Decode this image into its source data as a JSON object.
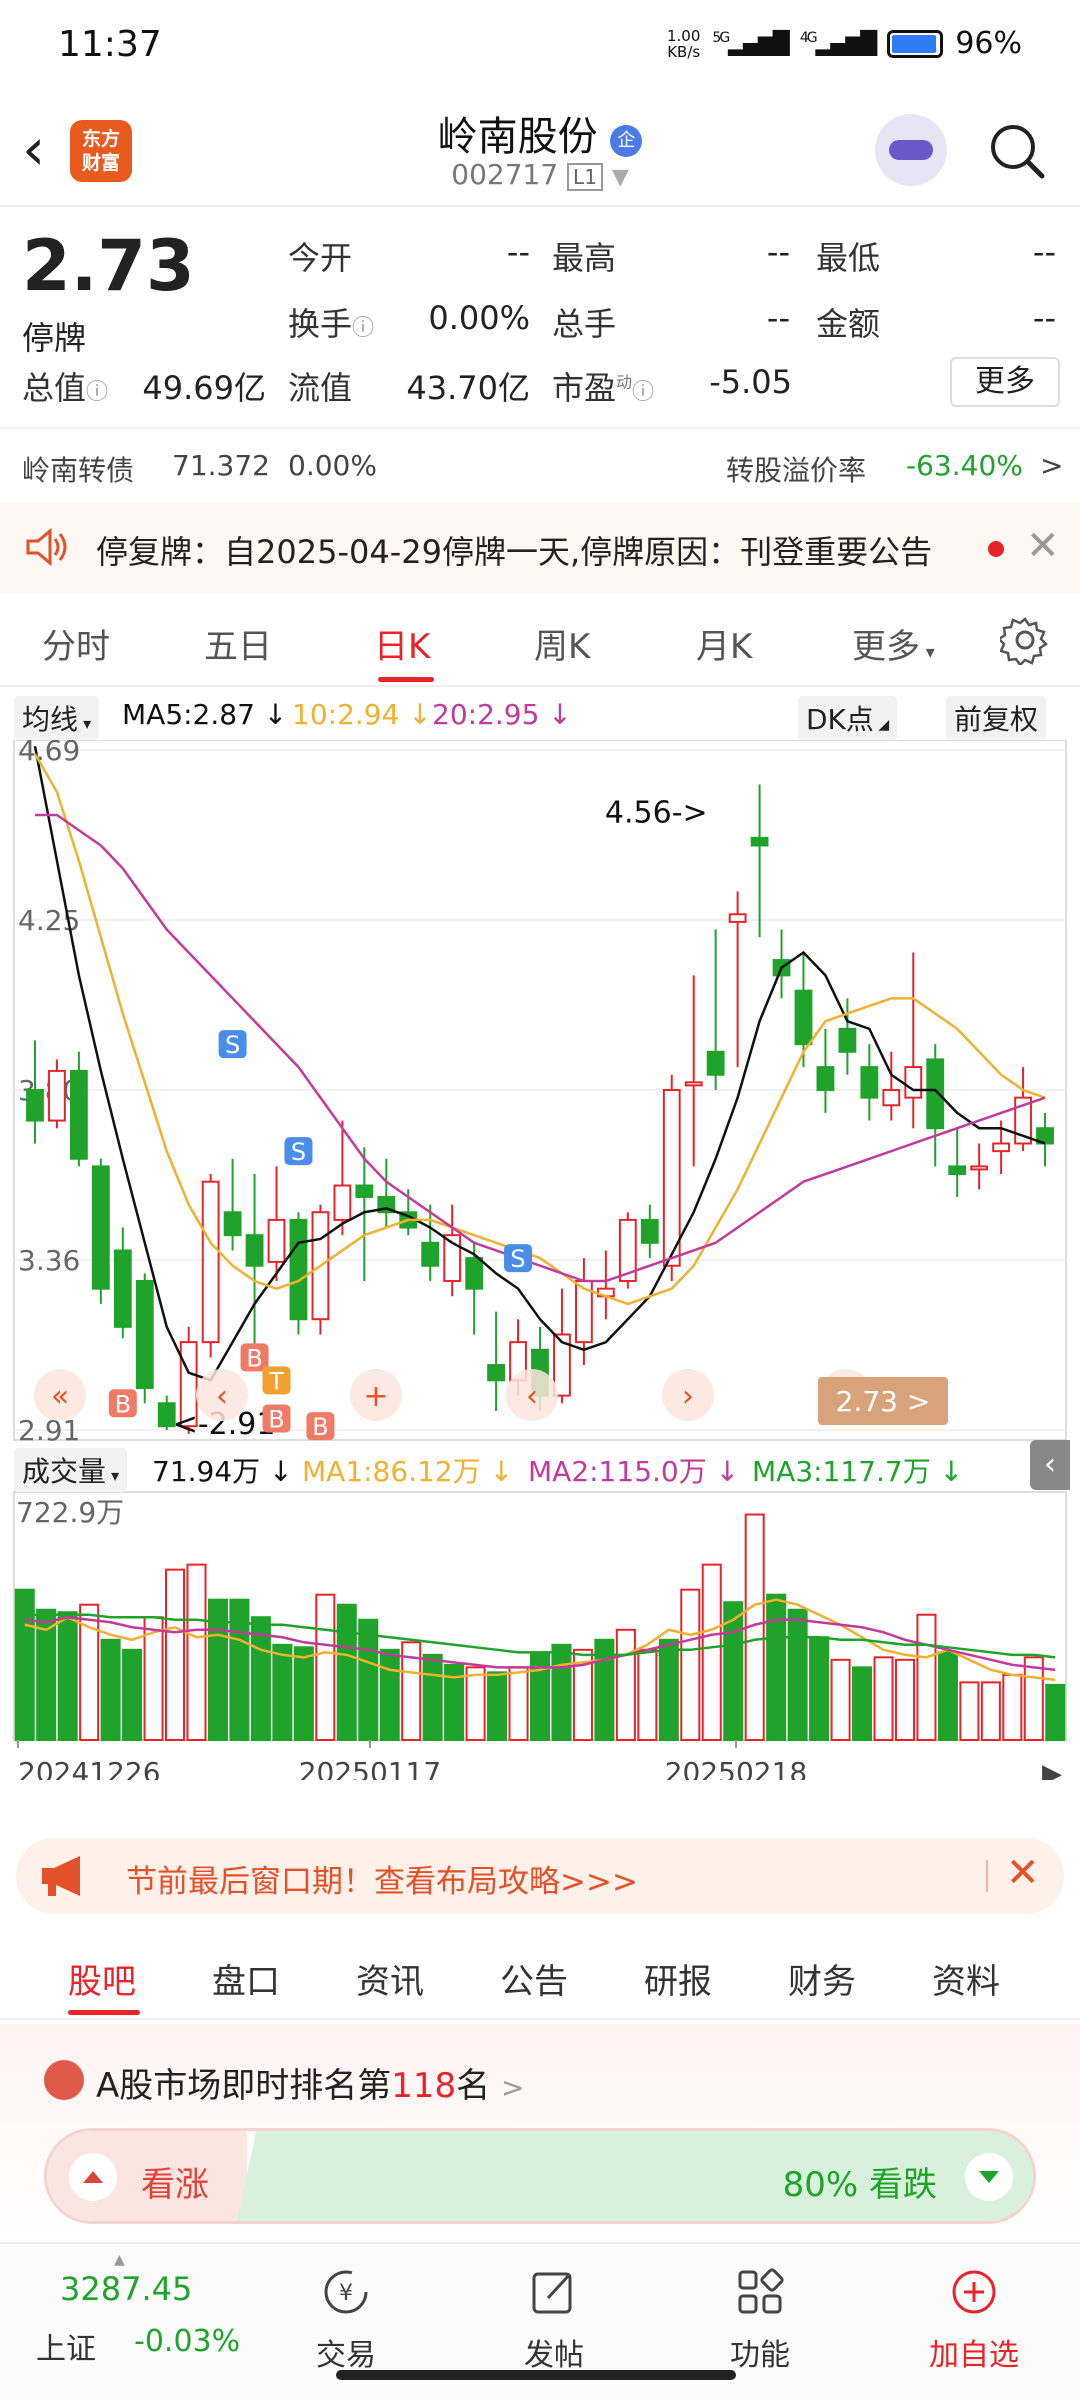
{
  "status_bar": {
    "time": "11:37",
    "net_speed_value": "1.00",
    "net_speed_unit": "KB/s",
    "sim1": "5G",
    "sim2": "4G",
    "battery": "96%"
  },
  "header": {
    "app_logo": "东方\n财富",
    "stock_name": "岭南股份",
    "qiye_badge": "企",
    "stock_code": "002717",
    "level": "L1"
  },
  "quote": {
    "price": "2.73",
    "status": "停牌",
    "fields": [
      {
        "label": "今开",
        "value": "--"
      },
      {
        "label": "最高",
        "value": "--"
      },
      {
        "label": "最低",
        "value": "--"
      },
      {
        "label": "换手",
        "value": "0.00%"
      },
      {
        "label": "总手",
        "value": "--"
      },
      {
        "label": "金额",
        "value": "--"
      },
      {
        "label": "总值",
        "value": "49.69亿"
      },
      {
        "label": "流值",
        "value": "43.70亿"
      },
      {
        "label": "市盈",
        "value": "-5.05"
      }
    ],
    "pe_sup": "动",
    "more_button": "更多"
  },
  "bond": {
    "name": "岭南转债",
    "price": "71.372",
    "change": "0.00%",
    "premium_label": "转股溢价率",
    "premium_value": "-63.40%",
    "arrow": ">"
  },
  "notice": {
    "text": "停复牌：自2025-04-29停牌一天,停牌原因：刊登重要公告",
    "close": "✕"
  },
  "period_tabs": [
    "分时",
    "五日",
    "日K",
    "周K",
    "月K",
    "更多"
  ],
  "period_active": 2,
  "indicator_row": {
    "ma_selector": "均线",
    "ma5": "MA5:2.87",
    "ma10": "10:2.94",
    "ma20": "20:2.95",
    "dk_button": "DK点",
    "adjust_button": "前复权"
  },
  "colors": {
    "up": "#e8242a",
    "down": "#1fa32a",
    "ma5": "#111111",
    "ma10": "#f0b030",
    "ma20": "#c23a9a",
    "ma3vol": "#1fa32a",
    "accent": "#e8242a"
  },
  "chart_data": [
    {
      "type": "candlestick",
      "y_ticks": [
        "4.69",
        "4.25",
        "3.80",
        "3.36",
        "2.91"
      ],
      "ylim": [
        2.91,
        4.69
      ],
      "annotations": {
        "high_label": "4.56->",
        "low_label": "<-2.91",
        "current_price_tag": "2.73 >"
      },
      "markers": [
        "S",
        "S",
        "S",
        "B",
        "B",
        "T",
        "B",
        "B"
      ],
      "candles": [
        [
          3.8,
          3.72,
          3.93,
          3.66
        ],
        [
          3.72,
          3.85,
          3.88,
          3.7
        ],
        [
          3.85,
          3.62,
          3.9,
          3.6
        ],
        [
          3.6,
          3.28,
          3.62,
          3.24
        ],
        [
          3.38,
          3.18,
          3.44,
          3.15
        ],
        [
          3.3,
          3.02,
          3.32,
          2.98
        ],
        [
          2.98,
          2.92,
          3.0,
          2.91
        ],
        [
          2.92,
          3.14,
          3.18,
          2.9
        ],
        [
          3.14,
          3.56,
          3.58,
          3.1
        ],
        [
          3.48,
          3.42,
          3.62,
          3.38
        ],
        [
          3.42,
          3.34,
          3.58,
          3.12
        ],
        [
          3.35,
          3.46,
          3.6,
          3.3
        ],
        [
          3.46,
          3.2,
          3.48,
          3.16
        ],
        [
          3.2,
          3.48,
          3.5,
          3.16
        ],
        [
          3.46,
          3.55,
          3.72,
          3.42
        ],
        [
          3.55,
          3.52,
          3.65,
          3.3
        ],
        [
          3.52,
          3.48,
          3.62,
          3.44
        ],
        [
          3.48,
          3.44,
          3.54,
          3.42
        ],
        [
          3.4,
          3.34,
          3.5,
          3.3
        ],
        [
          3.3,
          3.42,
          3.5,
          3.26
        ],
        [
          3.36,
          3.28,
          3.4,
          3.16
        ],
        [
          3.08,
          3.04,
          3.22,
          2.96
        ],
        [
          3.04,
          3.14,
          3.2,
          3.0
        ],
        [
          3.12,
          3.0,
          3.18,
          2.96
        ],
        [
          3.0,
          3.16,
          3.28,
          2.98
        ],
        [
          3.14,
          3.3,
          3.36,
          3.08
        ],
        [
          3.26,
          3.28,
          3.38,
          3.2
        ],
        [
          3.3,
          3.46,
          3.48,
          3.28
        ],
        [
          3.46,
          3.4,
          3.5,
          3.36
        ],
        [
          3.34,
          3.8,
          3.84,
          3.3
        ],
        [
          3.82,
          3.82,
          4.1,
          3.6
        ],
        [
          3.9,
          3.84,
          4.22,
          3.8
        ],
        [
          4.24,
          4.26,
          4.32,
          3.86
        ],
        [
          4.46,
          4.44,
          4.6,
          4.2
        ],
        [
          4.14,
          4.1,
          4.22,
          4.04
        ],
        [
          4.06,
          3.92,
          4.16,
          3.86
        ],
        [
          3.86,
          3.8,
          3.96,
          3.74
        ],
        [
          3.96,
          3.9,
          4.04,
          3.84
        ],
        [
          3.86,
          3.78,
          3.92,
          3.72
        ],
        [
          3.76,
          3.8,
          3.9,
          3.72
        ],
        [
          3.78,
          3.86,
          4.16,
          3.7
        ],
        [
          3.88,
          3.7,
          3.92,
          3.6
        ],
        [
          3.6,
          3.58,
          3.7,
          3.52
        ],
        [
          3.6,
          3.6,
          3.66,
          3.54
        ],
        [
          3.64,
          3.66,
          3.72,
          3.58
        ],
        [
          3.66,
          3.78,
          3.86,
          3.64
        ],
        [
          3.7,
          3.66,
          3.74,
          3.6
        ]
      ],
      "candle_fields": [
        "open",
        "close",
        "high",
        "low"
      ],
      "series": [
        {
          "name": "MA5",
          "values": [
            4.7,
            4.4,
            4.1,
            3.85,
            3.62,
            3.4,
            3.18,
            3.06,
            3.04,
            3.14,
            3.24,
            3.32,
            3.4,
            3.41,
            3.45,
            3.48,
            3.49,
            3.47,
            3.44,
            3.4,
            3.37,
            3.32,
            3.28,
            3.2,
            3.14,
            3.12,
            3.14,
            3.2,
            3.26,
            3.37,
            3.48,
            3.62,
            3.78,
            3.98,
            4.12,
            4.16,
            4.1,
            3.98,
            3.96,
            3.84,
            3.8,
            3.8,
            3.74,
            3.7,
            3.7,
            3.68,
            3.66
          ]
        },
        {
          "name": "MA10",
          "values": [
            4.68,
            4.58,
            4.4,
            4.2,
            4.0,
            3.82,
            3.64,
            3.5,
            3.4,
            3.34,
            3.3,
            3.28,
            3.3,
            3.34,
            3.38,
            3.42,
            3.44,
            3.46,
            3.46,
            3.44,
            3.42,
            3.4,
            3.38,
            3.36,
            3.32,
            3.28,
            3.26,
            3.24,
            3.26,
            3.28,
            3.34,
            3.44,
            3.54,
            3.66,
            3.78,
            3.9,
            3.98,
            4.0,
            4.02,
            4.04,
            4.04,
            4.0,
            3.96,
            3.9,
            3.84,
            3.8,
            3.78
          ]
        },
        {
          "name": "MA20",
          "values": [
            4.52,
            4.52,
            4.48,
            4.44,
            4.38,
            4.3,
            4.22,
            4.16,
            4.1,
            4.04,
            3.98,
            3.92,
            3.86,
            3.78,
            3.7,
            3.62,
            3.56,
            3.52,
            3.48,
            3.44,
            3.4,
            3.38,
            3.36,
            3.34,
            3.32,
            3.3,
            3.3,
            3.32,
            3.34,
            3.36,
            3.38,
            3.4,
            3.44,
            3.48,
            3.52,
            3.56,
            3.58,
            3.6,
            3.62,
            3.64,
            3.66,
            3.68,
            3.7,
            3.72,
            3.74,
            3.76,
            3.78
          ]
        }
      ]
    },
    {
      "type": "bar",
      "title": "成交量",
      "y_max_label": "722.9万",
      "current": "71.94万",
      "ma1": "MA1:86.12万",
      "ma2": "MA2:115.0万",
      "ma3": "MA3:117.7万",
      "x_tick_labels": [
        "20241226",
        "20250117",
        "20250218"
      ],
      "values": [
        6.0,
        5.2,
        5.1,
        5.4,
        4.0,
        3.6,
        4.9,
        6.8,
        7.0,
        5.6,
        5.6,
        4.9,
        3.8,
        3.7,
        5.8,
        5.4,
        4.8,
        3.6,
        3.9,
        3.4,
        3.0,
        2.9,
        2.7,
        2.9,
        3.5,
        3.8,
        3.6,
        4.0,
        4.4,
        3.6,
        4.0,
        6.0,
        7.0,
        5.5,
        9.0,
        5.8,
        5.2,
        4.1,
        3.2,
        2.9,
        3.3,
        3.2,
        5.0,
        3.5,
        2.3,
        2.3,
        2.6,
        3.3,
        2.2
      ],
      "up_flags": [
        0,
        0,
        0,
        1,
        0,
        0,
        1,
        1,
        1,
        0,
        0,
        0,
        0,
        0,
        1,
        0,
        0,
        0,
        1,
        0,
        0,
        1,
        0,
        1,
        0,
        0,
        1,
        0,
        1,
        1,
        0,
        1,
        1,
        0,
        1,
        0,
        0,
        0,
        1,
        0,
        1,
        1,
        1,
        0,
        1,
        1,
        1,
        1,
        0
      ],
      "series": [
        {
          "name": "MA1",
          "values": [
            4.6,
            4.4,
            4.9,
            4.5,
            4.2,
            4.0,
            4.3,
            4.5,
            4.1,
            4.2,
            4.0,
            3.6,
            3.4,
            3.3,
            3.5,
            3.4,
            3.1,
            2.8,
            2.7,
            2.6,
            2.5,
            2.6,
            2.6,
            2.7,
            2.8,
            3.0,
            3.1,
            3.2,
            3.4,
            3.8,
            4.4,
            4.2,
            4.4,
            4.8,
            5.4,
            5.6,
            5.4,
            5.0,
            4.6,
            4.1,
            3.6,
            3.4,
            3.3,
            3.6,
            3.2,
            2.8,
            2.6,
            2.5,
            2.4
          ]
        },
        {
          "name": "MA2",
          "values": [
            4.8,
            4.7,
            4.9,
            4.8,
            4.7,
            4.5,
            4.4,
            4.3,
            4.4,
            4.4,
            4.3,
            4.2,
            4.1,
            3.9,
            3.8,
            3.7,
            3.6,
            3.4,
            3.3,
            3.2,
            3.1,
            3.0,
            2.9,
            2.9,
            2.9,
            2.9,
            3.0,
            3.2,
            3.4,
            3.6,
            3.8,
            4.0,
            4.2,
            4.3,
            4.6,
            4.8,
            4.8,
            4.7,
            4.6,
            4.5,
            4.3,
            4.0,
            3.8,
            3.6,
            3.4,
            3.2,
            3.0,
            2.9,
            2.8
          ]
        },
        {
          "name": "MA3",
          "values": [
            5.0,
            5.0,
            5.0,
            5.0,
            4.9,
            4.9,
            4.9,
            4.8,
            4.8,
            4.7,
            4.7,
            4.6,
            4.6,
            4.5,
            4.4,
            4.3,
            4.2,
            4.1,
            4.0,
            3.9,
            3.8,
            3.7,
            3.6,
            3.5,
            3.5,
            3.5,
            3.4,
            3.4,
            3.4,
            3.5,
            3.6,
            3.6,
            3.7,
            3.8,
            4.0,
            4.1,
            4.1,
            4.1,
            4.0,
            4.0,
            3.9,
            3.8,
            3.8,
            3.7,
            3.6,
            3.5,
            3.4,
            3.4,
            3.3
          ]
        }
      ]
    }
  ],
  "promo": {
    "text": "节前最后窗口期！查看布局攻略>>>",
    "close": "✕"
  },
  "sub_tabs": [
    "股吧",
    "盘口",
    "资讯",
    "公告",
    "研报",
    "财务",
    "资料"
  ],
  "sub_active": 0,
  "rank": {
    "prefix": "A股市场即时排名第",
    "number": "118",
    "suffix": "名",
    "arrow": ">"
  },
  "vote": {
    "up_label": "看涨",
    "down_label": "80% 看跌"
  },
  "bottom_bar": {
    "index_value": "3287.45",
    "index_name": "上证",
    "index_change": "-0.03%",
    "items": [
      {
        "label": "交易",
        "icon": "trade-icon"
      },
      {
        "label": "发帖",
        "icon": "post-icon"
      },
      {
        "label": "功能",
        "icon": "apps-icon"
      },
      {
        "label": "加自选",
        "icon": "add-watchlist-icon"
      }
    ]
  }
}
